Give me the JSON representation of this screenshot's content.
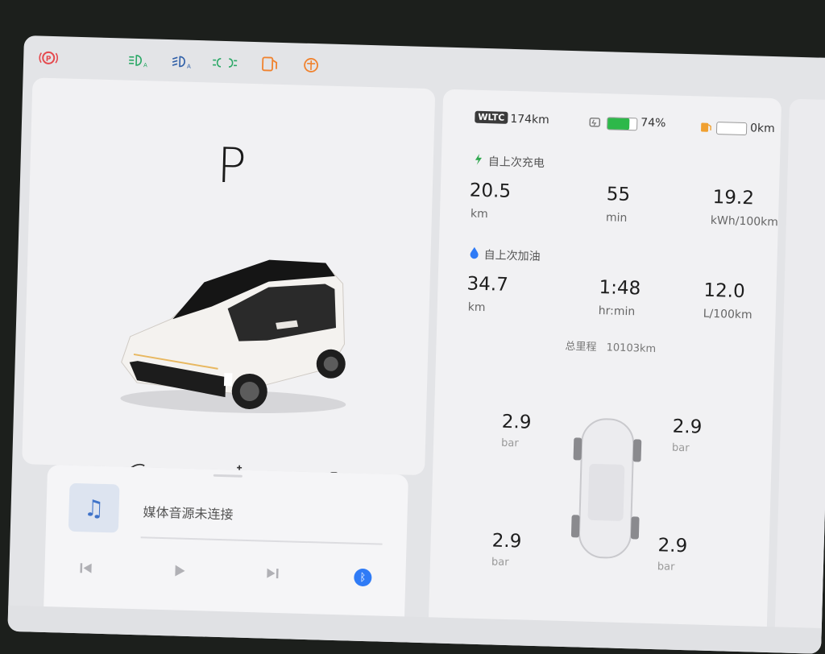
{
  "gear": "P",
  "status_icons": [
    "parking-brake-icon",
    "auto-high-beam-icon",
    "auto-headlight-icon",
    "position-lights-icon",
    "door-open-icon",
    "seatbelt-warning-icon"
  ],
  "energy": {
    "wltc_badge": "WLTC",
    "wltc_range": "174km",
    "battery_percent_text": "74%",
    "battery_level": 0.74,
    "fuel_range": "0km",
    "fuel_level": 0.0
  },
  "since_charge": {
    "label": "自上次充电",
    "distance": "20.5",
    "distance_unit": "km",
    "time": "55",
    "time_unit": "min",
    "consumption": "19.2",
    "consumption_unit": "kWh/100km"
  },
  "since_refuel": {
    "label": "自上次加油",
    "distance": "34.7",
    "distance_unit": "km",
    "time": "1:48",
    "time_unit": "hr:min",
    "consumption": "12.0",
    "consumption_unit": "L/100km"
  },
  "odometer": {
    "label": "总里程",
    "value": "10103km"
  },
  "tires": {
    "front_left": "2.9",
    "front_right": "2.9",
    "rear_left": "2.9",
    "rear_right": "2.9",
    "unit": "bar"
  },
  "media": {
    "status": "媒体音源未连接",
    "controls": [
      "previous-icon",
      "play-icon",
      "next-icon",
      "bluetooth-icon"
    ]
  },
  "colors": {
    "battery": "#2db84a",
    "charge_icon": "#2fa84f",
    "fuel_icon": "#2f7bf6",
    "warning_red": "#e5484d",
    "indicator_green": "#2aa866",
    "warning_orange": "#f0822e"
  }
}
